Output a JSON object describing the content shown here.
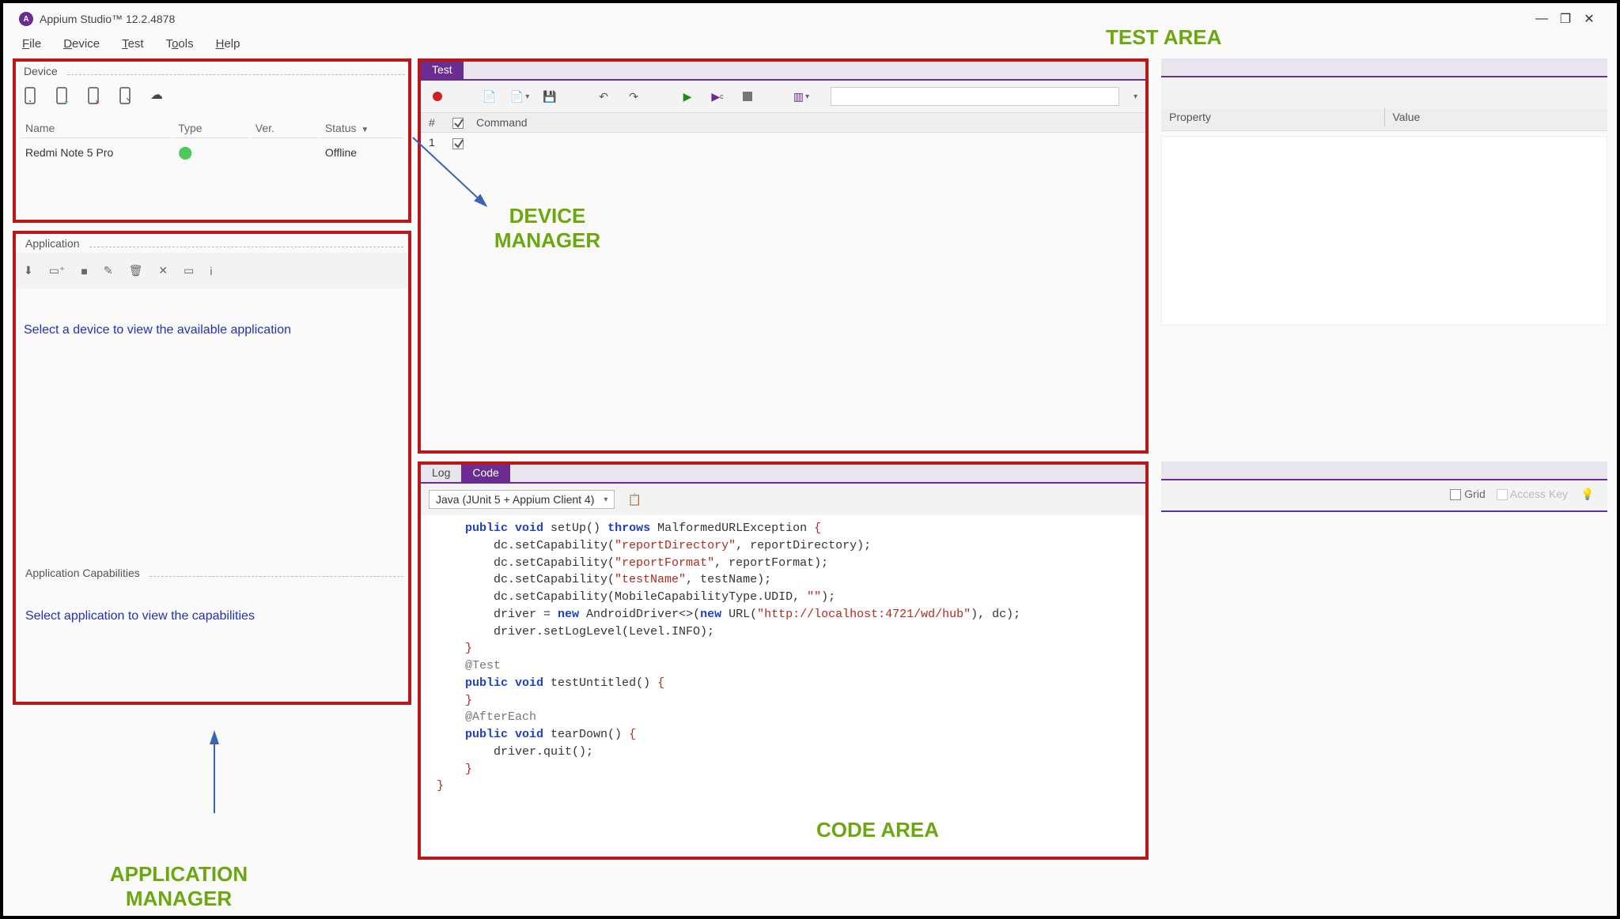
{
  "title": "Appium Studio™ 12.2.4878",
  "menubar": [
    "File",
    "Device",
    "Test",
    "Tools",
    "Help"
  ],
  "device_panel": {
    "title": "Device",
    "columns": [
      "Name",
      "Type",
      "Ver.",
      "Status"
    ],
    "rows": [
      {
        "name": "Redmi Note 5 Pro",
        "type": "android",
        "ver": "",
        "status": "Offline"
      }
    ]
  },
  "app_panel": {
    "title": "Application",
    "message": "Select a device to view the available application"
  },
  "caps_panel": {
    "title": "Application Capabilities",
    "message": "Select application to view the capabilities"
  },
  "test_panel": {
    "tab": "Test",
    "columns": {
      "num": "#",
      "command": "Command"
    },
    "rows": [
      {
        "num": "1"
      }
    ]
  },
  "prop_panel": {
    "columns": [
      "Property",
      "Value"
    ]
  },
  "code_panel": {
    "tabs": [
      "Log",
      "Code"
    ],
    "active_tab": "Code",
    "selector": "Java (JUnit 5 + Appium Client 4)",
    "grid_label": "Grid",
    "access_label": "Access Key"
  },
  "code_lines": [
    {
      "indent": 1,
      "parts": [
        {
          "t": "public void ",
          "c": "kw"
        },
        {
          "t": "setUp() "
        },
        {
          "t": "throws ",
          "c": "kw"
        },
        {
          "t": "MalformedURLException "
        },
        {
          "t": "{",
          "c": "brace"
        }
      ]
    },
    {
      "indent": 2,
      "parts": [
        {
          "t": "dc.setCapability("
        },
        {
          "t": "\"reportDirectory\"",
          "c": "str"
        },
        {
          "t": ", reportDirectory);"
        }
      ]
    },
    {
      "indent": 2,
      "parts": [
        {
          "t": "dc.setCapability("
        },
        {
          "t": "\"reportFormat\"",
          "c": "str"
        },
        {
          "t": ", reportFormat);"
        }
      ]
    },
    {
      "indent": 2,
      "parts": [
        {
          "t": "dc.setCapability("
        },
        {
          "t": "\"testName\"",
          "c": "str"
        },
        {
          "t": ", testName);"
        }
      ]
    },
    {
      "indent": 2,
      "parts": [
        {
          "t": "dc.setCapability(MobileCapabilityType.UDID, "
        },
        {
          "t": "\"\"",
          "c": "str"
        },
        {
          "t": ");"
        }
      ]
    },
    {
      "indent": 2,
      "parts": [
        {
          "t": "driver = "
        },
        {
          "t": "new ",
          "c": "kw"
        },
        {
          "t": "AndroidDriver<>("
        },
        {
          "t": "new ",
          "c": "kw"
        },
        {
          "t": "URL("
        },
        {
          "t": "\"http://localhost:4721/wd/hub\"",
          "c": "str"
        },
        {
          "t": "), dc);"
        }
      ]
    },
    {
      "indent": 2,
      "parts": [
        {
          "t": "driver.setLogLevel(Level.INFO);"
        }
      ]
    },
    {
      "indent": 1,
      "parts": [
        {
          "t": "}",
          "c": "brace"
        }
      ]
    },
    {
      "indent": 0,
      "parts": [
        {
          "t": ""
        }
      ]
    },
    {
      "indent": 1,
      "parts": [
        {
          "t": "@Test",
          "c": "ann-java"
        }
      ]
    },
    {
      "indent": 1,
      "parts": [
        {
          "t": "public void ",
          "c": "kw"
        },
        {
          "t": "testUntitled() "
        },
        {
          "t": "{",
          "c": "brace"
        }
      ]
    },
    {
      "indent": 1,
      "parts": [
        {
          "t": "}",
          "c": "brace"
        }
      ]
    },
    {
      "indent": 0,
      "parts": [
        {
          "t": ""
        }
      ]
    },
    {
      "indent": 1,
      "parts": [
        {
          "t": "@AfterEach",
          "c": "ann-java"
        }
      ]
    },
    {
      "indent": 1,
      "parts": [
        {
          "t": "public void ",
          "c": "kw"
        },
        {
          "t": "tearDown() "
        },
        {
          "t": "{",
          "c": "brace"
        }
      ]
    },
    {
      "indent": 2,
      "parts": [
        {
          "t": "driver.quit();"
        }
      ]
    },
    {
      "indent": 1,
      "parts": [
        {
          "t": "}",
          "c": "brace"
        }
      ]
    },
    {
      "indent": 0,
      "parts": [
        {
          "t": "}",
          "c": "brace"
        }
      ]
    }
  ],
  "annotations": {
    "test_area": "TEST AREA",
    "device_manager": "DEVICE MANAGER",
    "code_area": "CODE AREA",
    "app_manager": "APPLICATION MANAGER"
  }
}
